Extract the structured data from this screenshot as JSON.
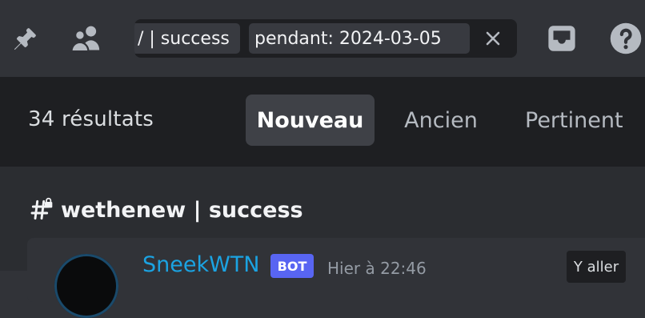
{
  "toolbar": {
    "icons": {
      "pin": "pin-icon",
      "members": "members-icon",
      "inbox": "inbox-icon",
      "help": "help-icon"
    },
    "search": {
      "chip_in": "/ | success",
      "chip_during": "pendant: 2024-03-05",
      "clear_icon": "close-icon"
    }
  },
  "results": {
    "count_label": "34 résultats",
    "sort_tabs": [
      {
        "label": "Nouveau",
        "selected": true
      },
      {
        "label": "Ancien",
        "selected": false
      },
      {
        "label": "Pertinent",
        "selected": false
      }
    ]
  },
  "channel": {
    "icon": "locked-channel-hash-icon",
    "name": "wethenew | success"
  },
  "message": {
    "author": "SneekWTN",
    "bot_tag": "BOT",
    "timestamp": "Hier à 22:46",
    "jump_label": "Y aller"
  },
  "colors": {
    "background": "#313338",
    "header_background": "#1e1f22",
    "list_background": "#2b2d31",
    "accent_bot": "#5865f2",
    "author_color": "#1ba3e2",
    "icon_color": "#b5bac1"
  }
}
